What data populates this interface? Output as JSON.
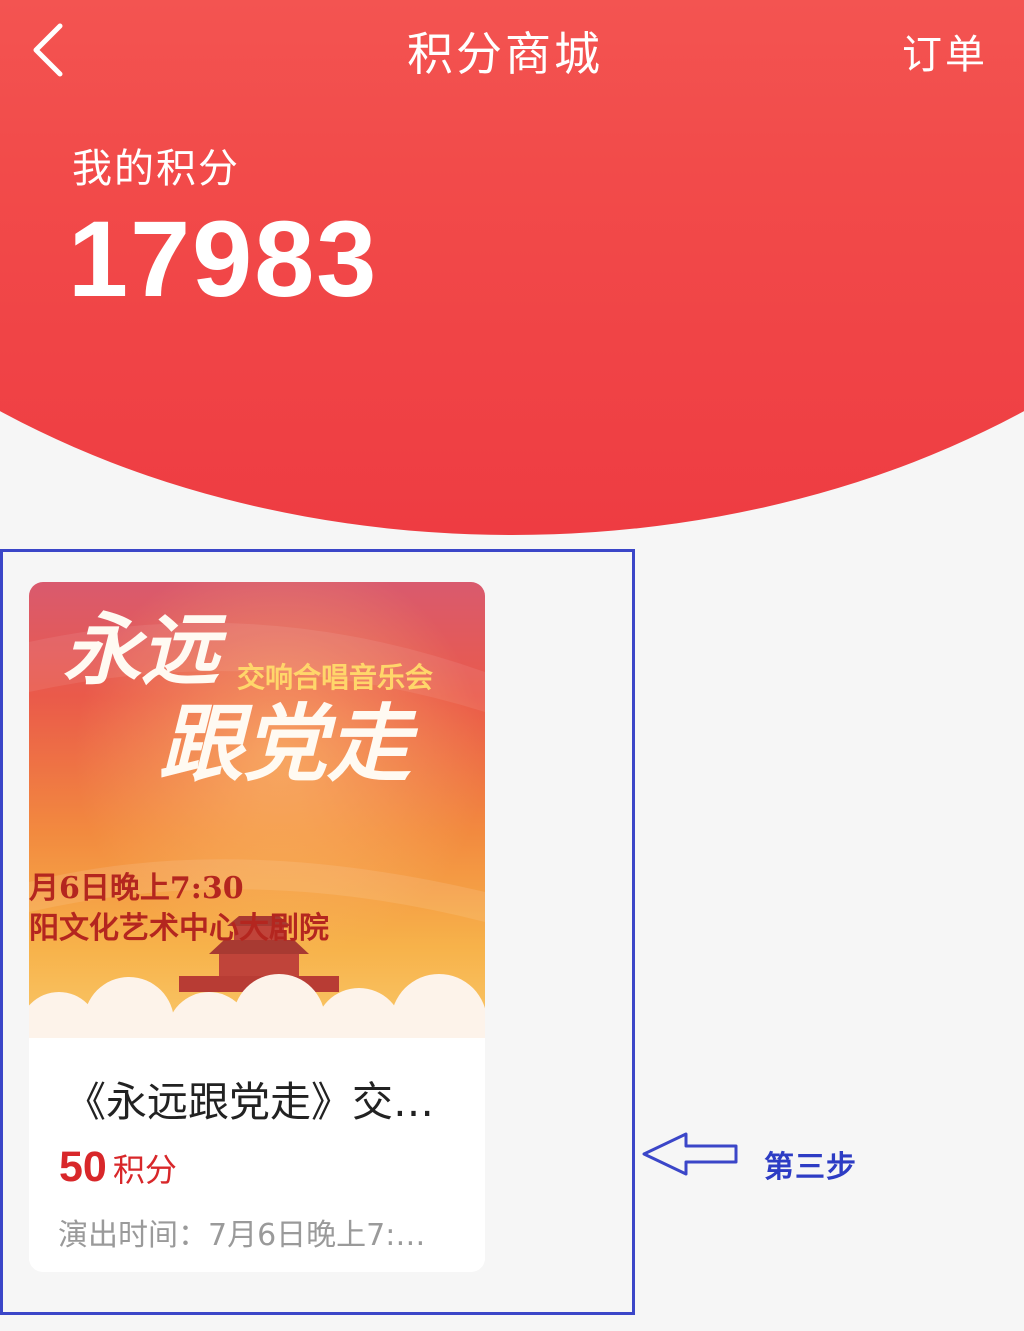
{
  "nav": {
    "title": "积分商城",
    "back_icon": "chevron-left-icon",
    "orders_label": "订单"
  },
  "points": {
    "label": "我的积分",
    "value": "17983"
  },
  "product": {
    "title": "《永远跟党走》交…",
    "price_value": "50",
    "price_unit": "积分",
    "show_time": "演出时间：7月6日晚上7:…",
    "poster": {
      "main_title_line1": "永远",
      "main_title_line2": "跟党走",
      "subtitle": "交响合唱音乐会",
      "date_line": "月6日晚上7:30",
      "venue_line": "阳文化艺术中心大剧院"
    }
  },
  "annotation": {
    "step_label": "第三步",
    "arrow_icon": "arrow-left-icon"
  },
  "colors": {
    "header_red": "#f24b4a",
    "price_red": "#d8272a",
    "annotation_blue": "#3b46c8"
  }
}
